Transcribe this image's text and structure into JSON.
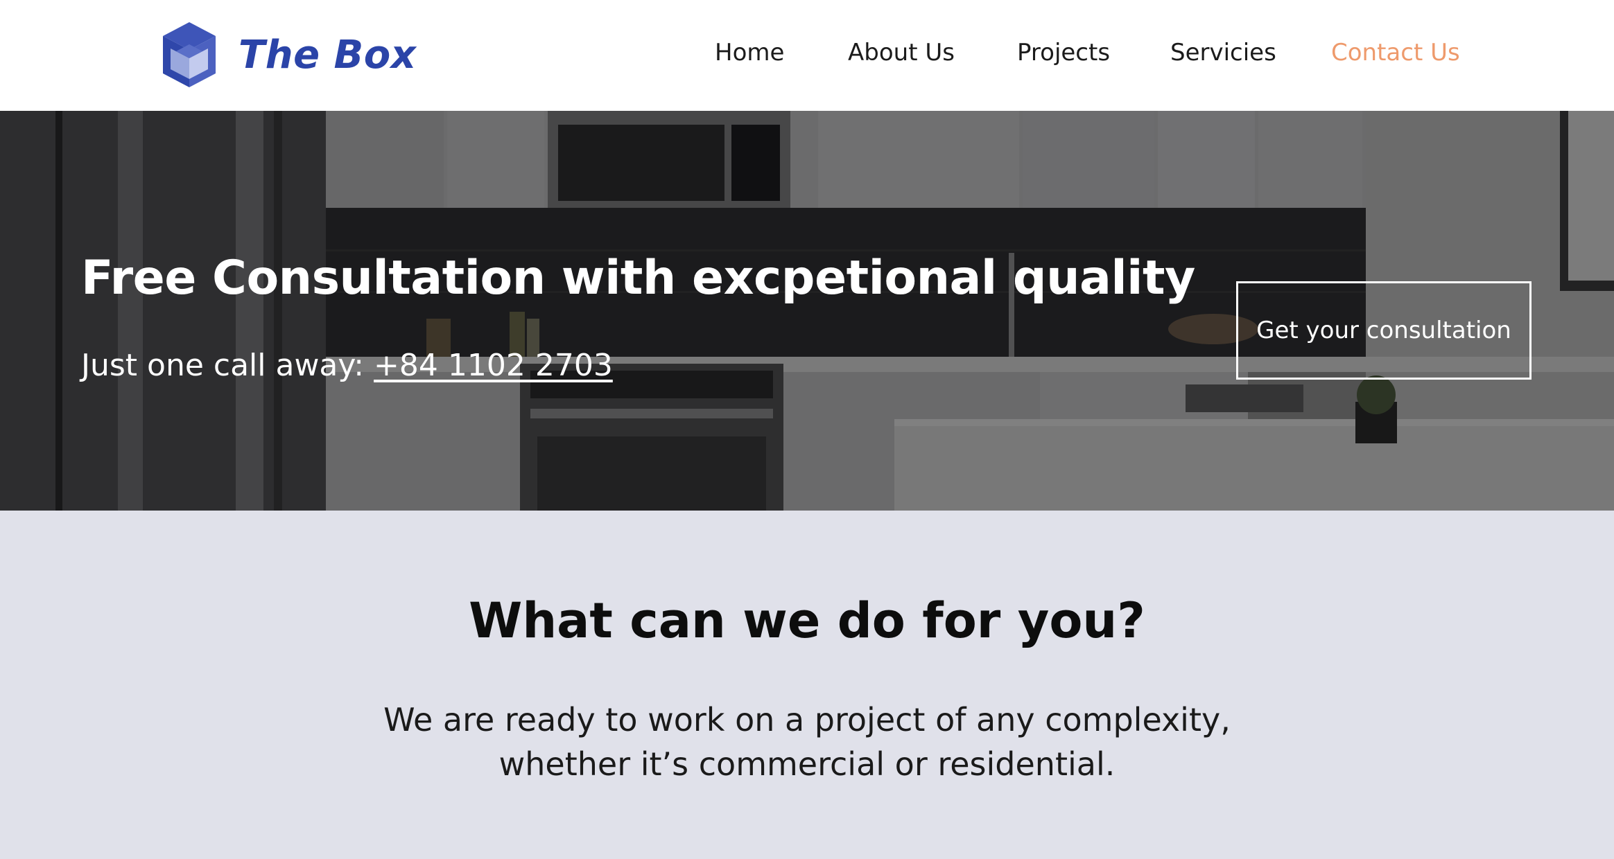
{
  "brand": {
    "name": "The Box",
    "logo_icon": "cube-logo-icon",
    "color": "#2b44a8"
  },
  "nav": {
    "items": [
      {
        "label": "Home",
        "active": false
      },
      {
        "label": "About Us",
        "active": false
      },
      {
        "label": "Projects",
        "active": false
      },
      {
        "label": "Servicies",
        "active": false
      },
      {
        "label": "Contact Us",
        "active": true
      }
    ],
    "active_color": "#ee9a6c"
  },
  "hero": {
    "title": "Free Consultation with excpetional quality",
    "subtitle_prefix": "Just one call away: ",
    "phone": "+84 1102 2703",
    "cta_label": "Get your consultation",
    "background": "kitchen-photo"
  },
  "services": {
    "title": "What can we do for you?",
    "text_line1": "We are ready to work on a project of any complexity,",
    "text_line2": "whether it’s commercial or residential.",
    "background": "#e0e1ea"
  }
}
